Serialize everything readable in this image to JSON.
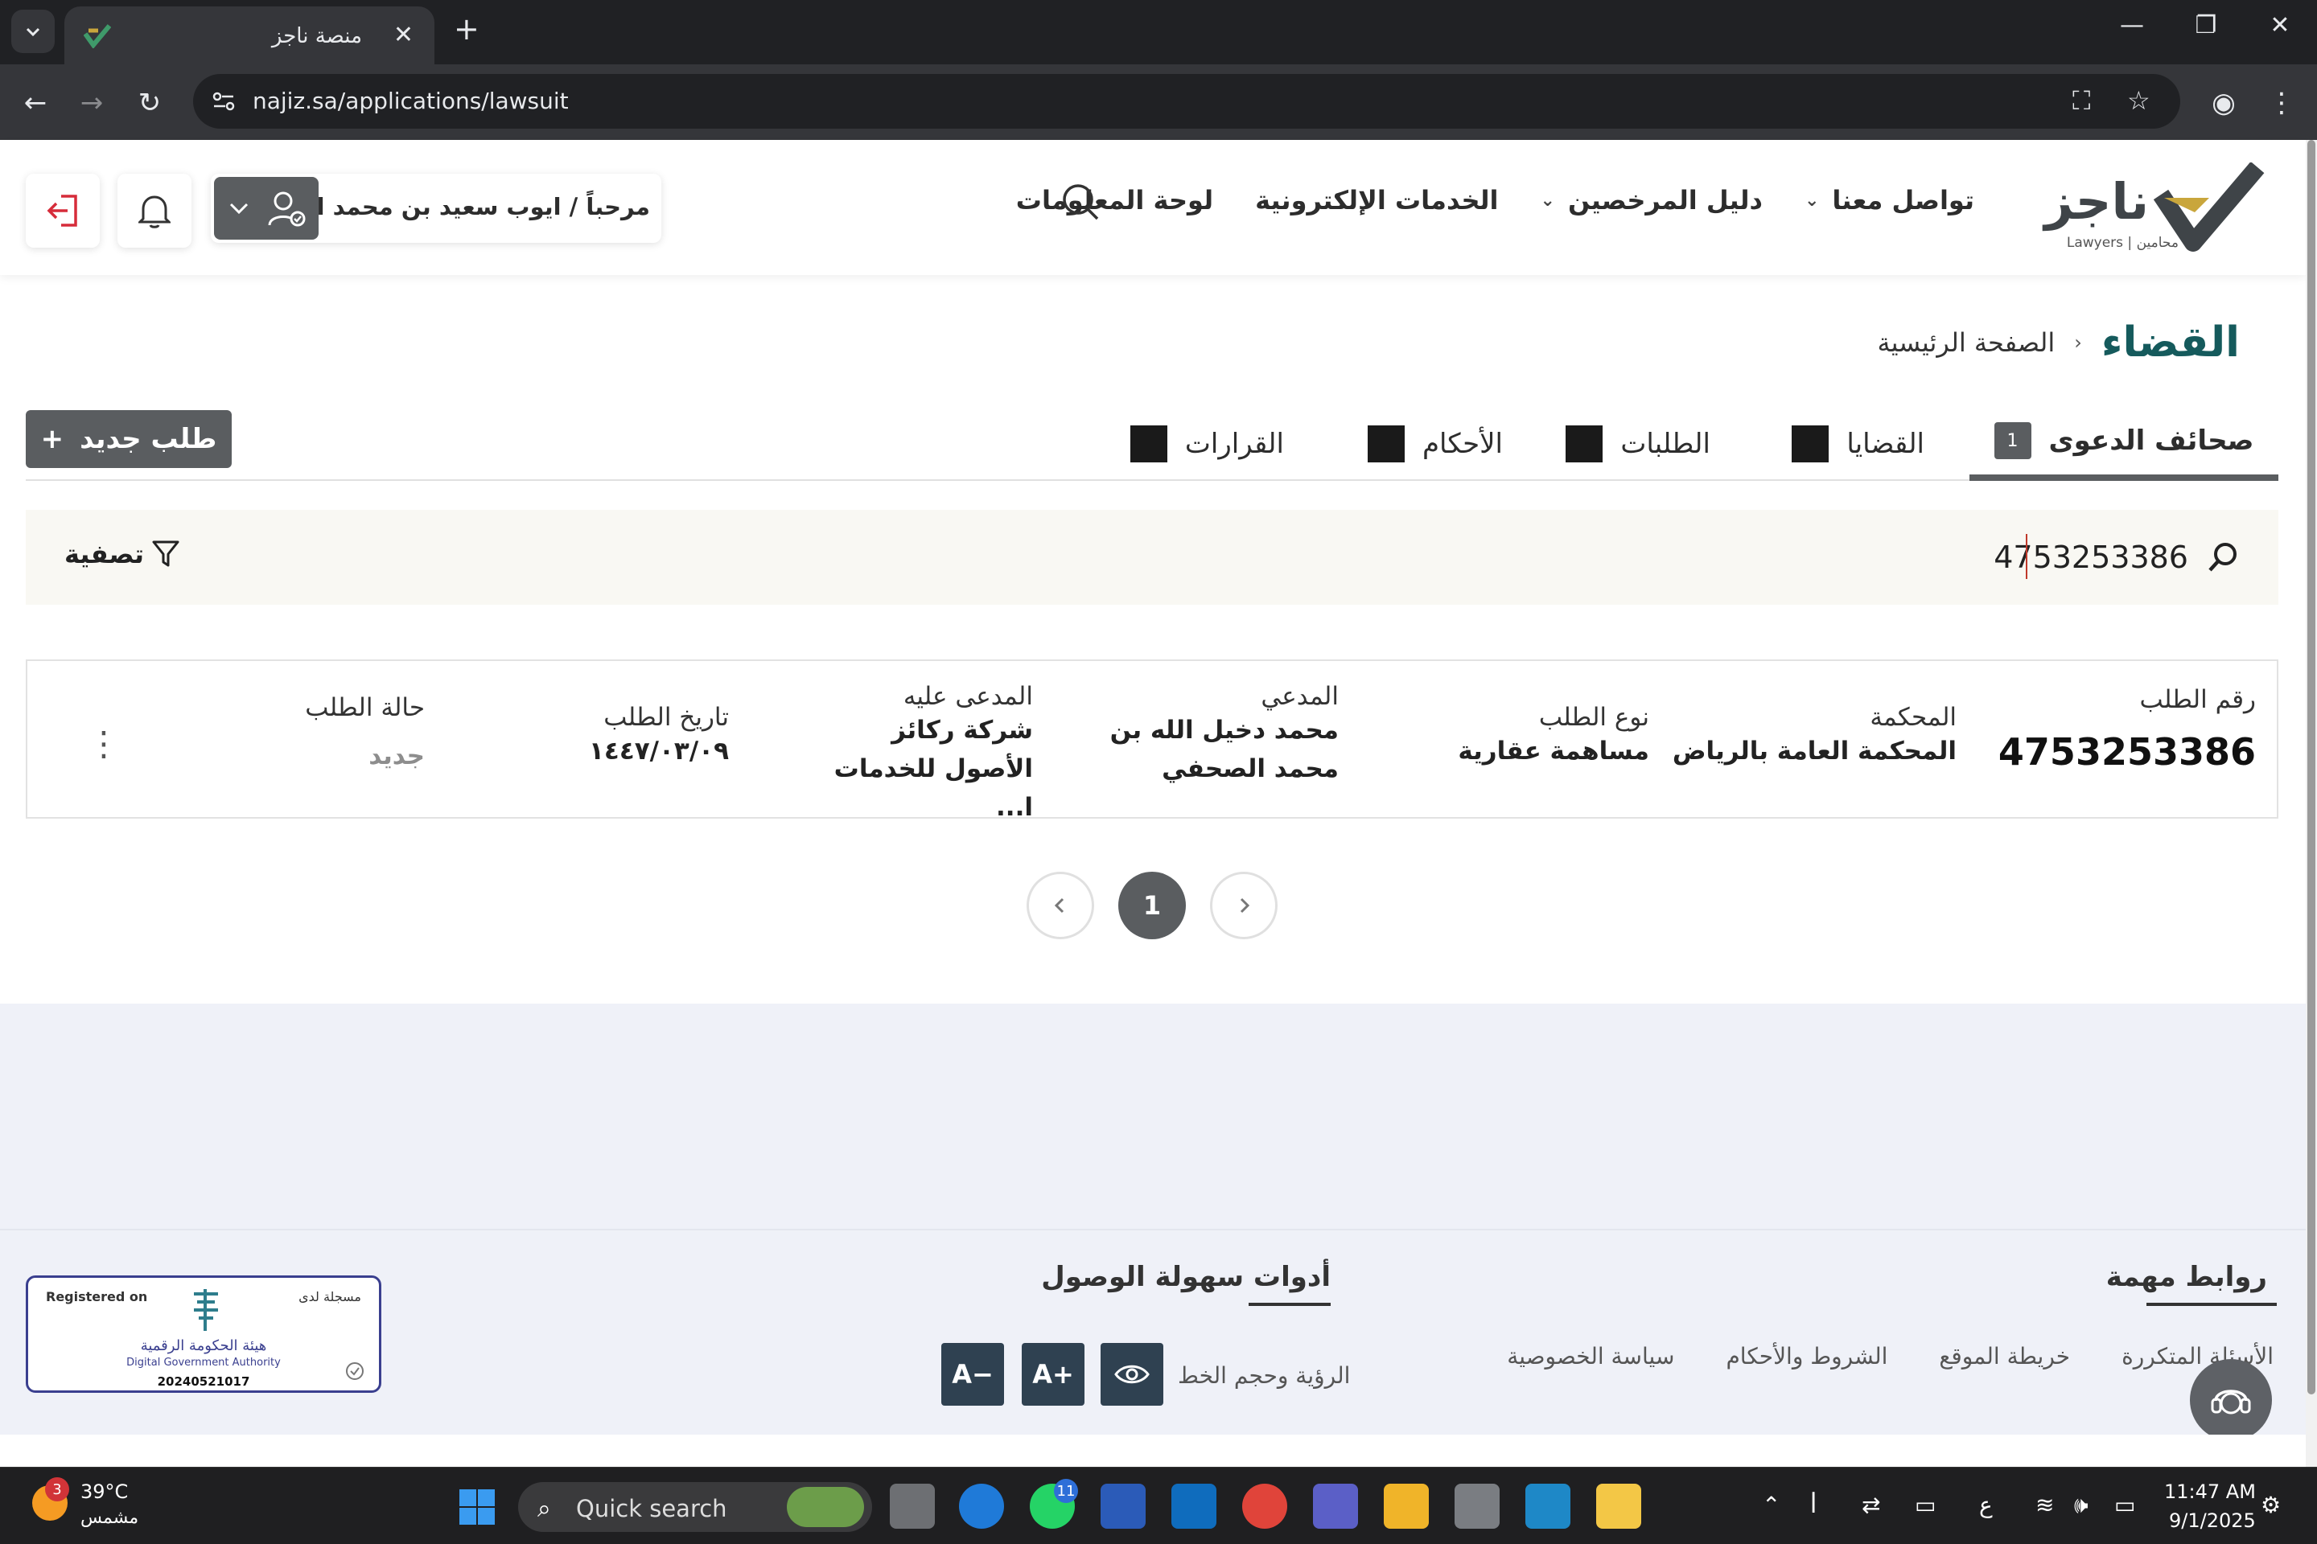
{
  "browser": {
    "tab_title": "منصة ناجز",
    "url": "najiz.sa/applications/lawsuit"
  },
  "header": {
    "logo_text": "ناجز",
    "logo_sub": "Lawyers | محامين",
    "nav": [
      {
        "label": "لوحة المعلومات"
      },
      {
        "label": "الخدمات الإلكترونية"
      },
      {
        "label": "دليل المرخصين"
      },
      {
        "label": "تواصل معنا"
      }
    ],
    "user_greeting": "مرحباً / ايوب سعيد بن محمد القرني"
  },
  "breadcrumb": {
    "home": "الصفحة الرئيسية",
    "separator": "‹",
    "current": "القضاء"
  },
  "tabs": [
    {
      "label": "صحائف الدعوى",
      "badge": "1"
    },
    {
      "label": "القضايا",
      "badge": ""
    },
    {
      "label": "الطلبات",
      "badge": ""
    },
    {
      "label": "الأحكام",
      "badge": ""
    },
    {
      "label": "القرارات",
      "badge": ""
    }
  ],
  "new_request_button": "طلب جديد",
  "filter": {
    "search_value": "4753253386",
    "filter_label": "تصفية"
  },
  "request_card": {
    "number_label": "رقم الطلب",
    "number_value": "4753253386",
    "court_label": "المحكمة",
    "court_value": "المحكمة العامة بالرياض",
    "type_label": "نوع الطلب",
    "type_value": "مساهمة عقارية",
    "plaintiff_label": "المدعي",
    "plaintiff_value": "محمد دخيل الله بن محمد الصحفي",
    "defendant_label": "المدعى عليه",
    "defendant_value": "شركة ركائز الأصول للخدمات ا...",
    "date_label": "تاريخ الطلب",
    "date_value": "١٤٤٧/٠٣/٠٩",
    "status_label": "حالة الطلب",
    "status_value": "جديد"
  },
  "pagination": {
    "current": "1"
  },
  "footer": {
    "links_title": "روابط مهمة",
    "links": [
      "سياسة الخصوصية",
      "الشروط والأحكام",
      "خريطة الموقع",
      "الأسئلة المتكررة"
    ],
    "access_title": "أدوات سهولة الوصول",
    "access_label": "الرؤية وحجم الخط",
    "font_increase": "A+",
    "font_decrease": "A−",
    "dga": {
      "registered_en": "Registered on",
      "registered_ar": "مسجلة لدى",
      "name_ar": "هيئة الحكومة الرقمية",
      "name_en": "Digital Government Authority",
      "id": "20240521017"
    }
  },
  "taskbar": {
    "temp": "39°C",
    "weather": "مشمس",
    "weather_badge": "3",
    "search_placeholder": "Quick search",
    "whatsapp_badge": "11",
    "lang": "ع",
    "time": "11:47 AM",
    "date": "9/1/2025"
  },
  "colors": {
    "accent_teal": "#155a5c",
    "button_gray": "#5a5d60",
    "logo_gold": "#c9a63c",
    "footer_bg": "#eff1f8"
  }
}
